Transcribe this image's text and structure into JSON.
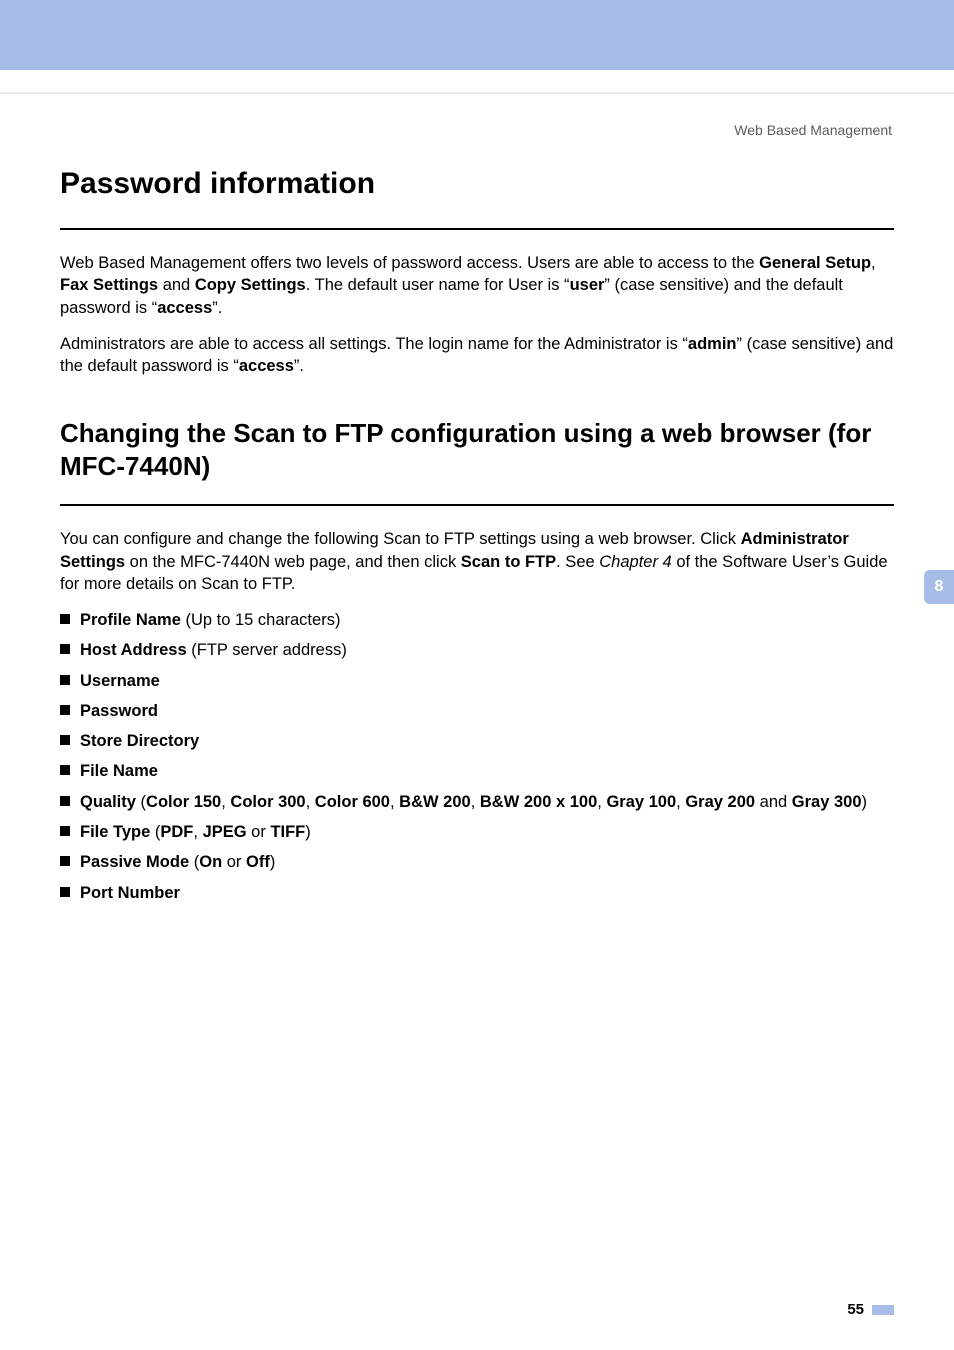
{
  "header": {
    "section": "Web Based Management"
  },
  "tab": {
    "number": "8"
  },
  "footer": {
    "page": "55"
  },
  "h1": "Password information",
  "p1_parts": {
    "a": "Web Based Management offers two levels of password access. Users are able to access to the ",
    "b_general": "General Setup",
    "c": ", ",
    "b_fax": "Fax Settings",
    "d": " and ",
    "b_copy": "Copy Settings",
    "e": ". The default user name for User is “",
    "b_user": "user",
    "f": "” (case sensitive) and the default password is “",
    "b_access": "access",
    "g": "”."
  },
  "p2_parts": {
    "a": "Administrators are able to access all settings. The login name for the Administrator is “",
    "b_admin": "admin",
    "c": "” (case sensitive) and the default password is “",
    "b_access": "access",
    "d": "”."
  },
  "h2": "Changing the Scan to FTP configuration using a web browser (for MFC-7440N)",
  "p3_parts": {
    "a": "You can configure and change the following Scan to FTP settings using a web browser. Click ",
    "b_admin_settings": "Administrator Settings",
    "b_mid": " on the MFC-7440N web page, and then click ",
    "b_scan": "Scan to FTP",
    "c": ". See ",
    "i_chap": "Chapter 4",
    "d": " of the Software User’s Guide for more details on Scan to FTP."
  },
  "list": {
    "profile": {
      "b": "Profile Name",
      "rest": " (Up to 15 characters)"
    },
    "host": {
      "b": "Host Address",
      "rest": " (FTP server address)"
    },
    "user": {
      "b": "Username"
    },
    "pass": {
      "b": "Password"
    },
    "store": {
      "b": "Store Directory"
    },
    "file": {
      "b": "File Name"
    },
    "quality": {
      "b": "Quality",
      "open": " (",
      "o1": "Color 150",
      "sep": ", ",
      "o2": "Color 300",
      "o3": "Color 600",
      "o4": "B&W 200",
      "o5": "B&W 200 x 100",
      "o6": "Gray 100",
      "o7": "Gray 200",
      "and": " and ",
      "o8": "Gray 300",
      "close": ")"
    },
    "ftype": {
      "b": "File Type",
      "open": " (",
      "o1": "PDF",
      "sep": ", ",
      "o2": "JPEG",
      "or": " or ",
      "o3": "TIFF",
      "close": ")"
    },
    "passive": {
      "b": "Passive Mode",
      "open": " (",
      "o1": "On",
      "or": " or ",
      "o2": "Off",
      "close": ")"
    },
    "port": {
      "b": "Port Number"
    }
  }
}
